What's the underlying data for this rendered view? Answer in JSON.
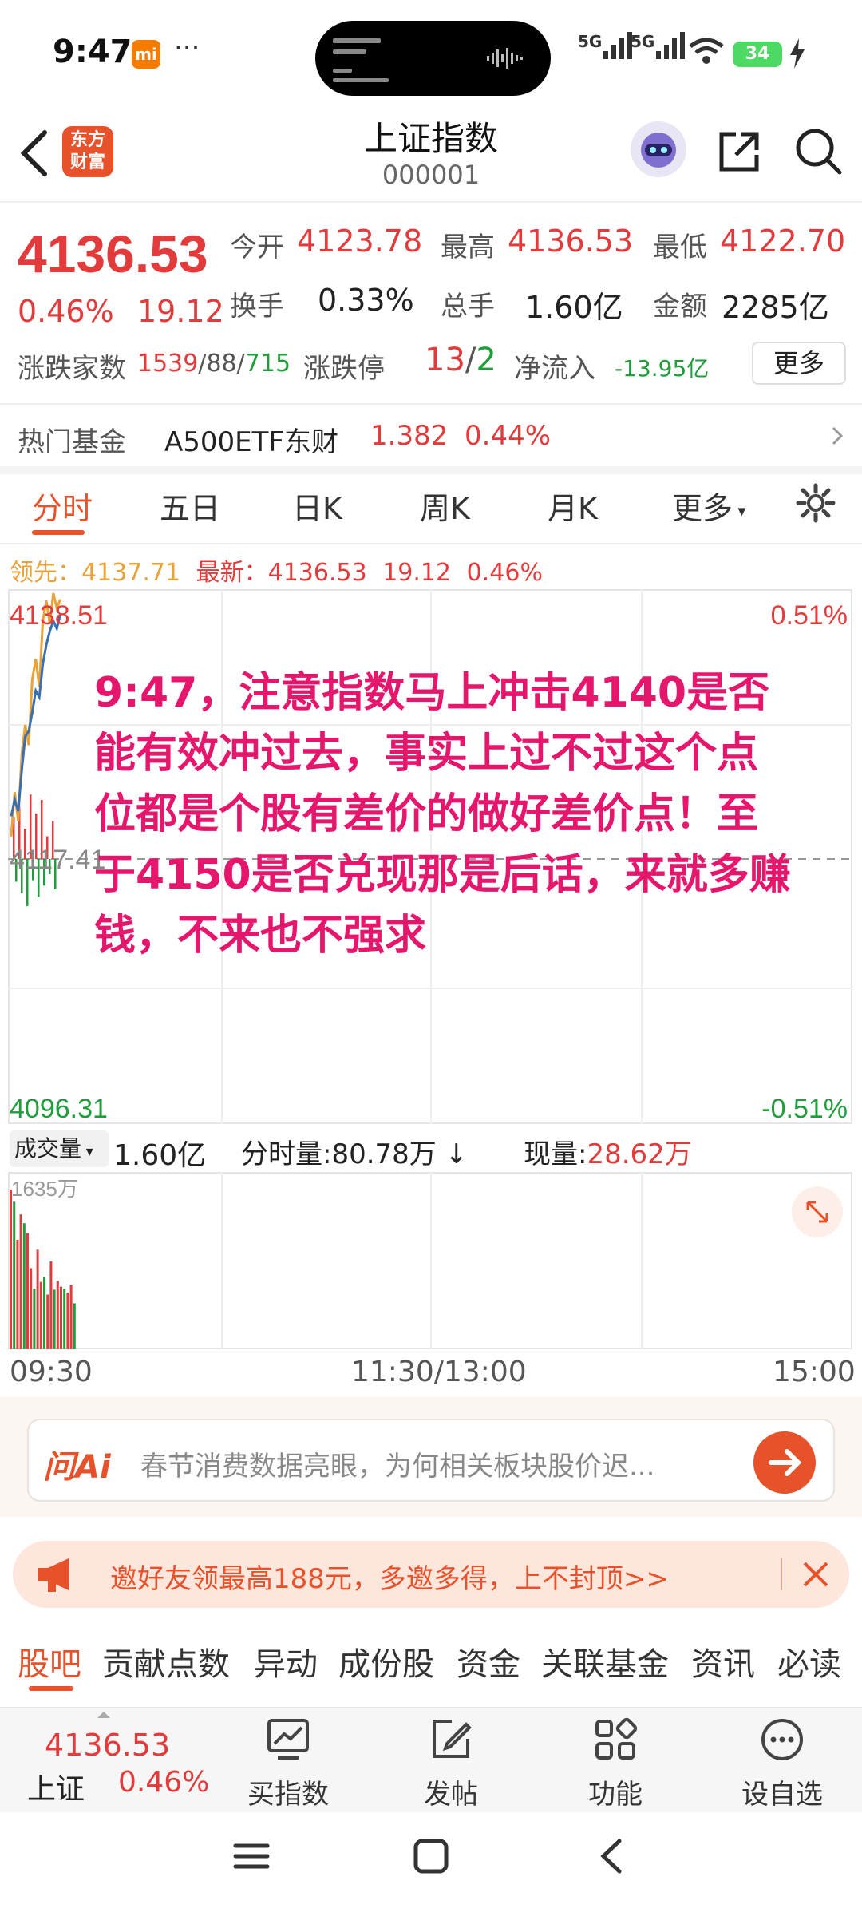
{
  "status": {
    "time": "9:47",
    "mi_badge": "mi",
    "dots": "···",
    "net1": "5G",
    "net2": "5G",
    "battery": "34"
  },
  "header": {
    "logo_line1": "东方",
    "logo_line2": "财富",
    "title": "上证指数",
    "code": "000001"
  },
  "quote": {
    "price": "4136.53",
    "pct": "0.46%",
    "change": "19.12",
    "open_label": "今开",
    "open": "4123.78",
    "high_label": "最高",
    "high": "4136.53",
    "low_label": "最低",
    "low": "4122.70",
    "turnover_label": "换手",
    "turnover": "0.33%",
    "volume_label": "总手",
    "volume": "1.60亿",
    "amount_label": "金额",
    "amount": "2285亿",
    "breadth_label": "涨跌家数",
    "up": "1539",
    "flat": "88",
    "down": "715",
    "limit_label": "涨跌停",
    "limit_up": "13",
    "limit_down": "2",
    "netflow_label": "净流入",
    "netflow": "-13.95亿",
    "more": "更多"
  },
  "fund": {
    "label": "热门基金",
    "name": "A500ETF东财",
    "price": "1.382",
    "pct": "0.44%"
  },
  "tabs": [
    "分时",
    "五日",
    "日K",
    "周K",
    "月K",
    "更多"
  ],
  "legend": {
    "lead_label": "领先：",
    "lead": "4137.71",
    "latest_label": "最新：",
    "latest": "4136.53",
    "change": "19.12",
    "pct": "0.46%"
  },
  "chart": {
    "top_price": "4138.51",
    "top_pct": "0.51%",
    "mid_price": "4117.41",
    "bottom_price": "4096.31",
    "bottom_pct": "-0.51%"
  },
  "annotation": "9:47，注意指数马上冲击4140是否能有效冲过去，事实上过不过这个点位都是个股有差价的做好差价点！至于4150是否兑现那是后话，来就多赚钱，不来也不强求",
  "volume_bar": {
    "selector": "成交量",
    "total": "1.60亿",
    "tick_label": "分时量:",
    "tick": "80.78万",
    "now_label": "现量:",
    "now": "28.62万",
    "max": "1635万"
  },
  "time_axis": {
    "start": "09:30",
    "mid": "11:30/13:00",
    "end": "15:00"
  },
  "ai": {
    "brand": "问Ai",
    "placeholder": "春节消费数据亮眼，为何相关板块股价迟..."
  },
  "promo": {
    "text": "邀好友领最高188元，多邀多得，上不封顶>>"
  },
  "bottom_tabs": [
    "股吧",
    "贡献点数",
    "异动",
    "成份股",
    "资金",
    "关联基金",
    "资讯",
    "必读"
  ],
  "toolbar": {
    "price": "4136.53",
    "name": "上证",
    "pct": "0.46%",
    "buy": "买指数",
    "post": "发帖",
    "func": "功能",
    "fav": "设自选"
  },
  "colors": {
    "up": "#e33b3b",
    "down": "#1f9d3a",
    "accent": "#e8522b",
    "annotation": "#e6166d",
    "lead_line": "#e8a23a",
    "price_line": "#3a6fb0"
  },
  "intraday": {
    "price": [
      4120.6,
      4121.9,
      4121.0,
      4124.2,
      4126.9,
      4127.3,
      4128.8,
      4130.5,
      4130.0,
      4132.6,
      4134.1,
      4135.2,
      4136.0,
      4135.4,
      4136.53
    ],
    "lead": [
      4119.0,
      4122.5,
      4120.2,
      4125.5,
      4127.8,
      4126.2,
      4131.4,
      4133.0,
      4130.8,
      4136.0,
      4137.6,
      4135.8,
      4138.2,
      4137.0,
      4137.71
    ],
    "flow_up": [
      0.55,
      0.7,
      0.4,
      0.85,
      0.6,
      0.78,
      0.3,
      0.5
    ],
    "flow_down": [
      0.3,
      0.45,
      0.62,
      0.28,
      0.5,
      0.35,
      0.2,
      0.4
    ],
    "volume": [
      1635,
      1510,
      1120,
      1380,
      1290,
      1190,
      830,
      620,
      1020,
      690,
      740,
      560,
      900,
      610,
      700,
      640,
      620,
      580,
      660,
      470
    ]
  }
}
